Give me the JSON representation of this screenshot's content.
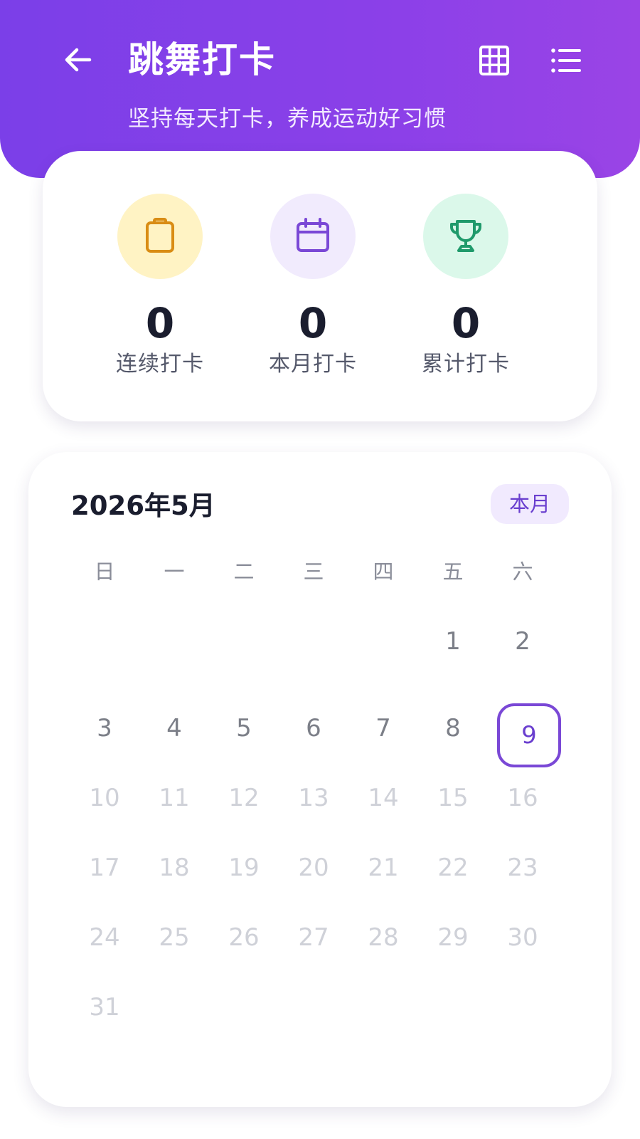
{
  "header": {
    "title": "跳舞打卡",
    "subtitle": "坚持每天打卡，养成运动好习惯",
    "accent_color": "#8b40e8",
    "icons": [
      "arrow-left-icon",
      "grid-icon",
      "list-icon"
    ]
  },
  "stats": [
    {
      "value": "0",
      "label": "连续打卡",
      "icon": "clipboard-icon",
      "icon_color": "#d98c14",
      "bg_color": "#fff3c4"
    },
    {
      "value": "0",
      "label": "本月打卡",
      "icon": "calendar-icon",
      "icon_color": "#7a48d6",
      "bg_color": "#f1ebfd"
    },
    {
      "value": "0",
      "label": "累计打卡",
      "icon": "trophy-icon",
      "icon_color": "#1f9a6b",
      "bg_color": "#dbf8ea"
    }
  ],
  "calendar": {
    "month_label": "2026年5月",
    "today_button": "本月",
    "weekdays": [
      "日",
      "一",
      "二",
      "三",
      "四",
      "五",
      "六"
    ],
    "days": [
      "1",
      "2",
      "3",
      "4",
      "5",
      "6",
      "7",
      "8",
      "9",
      "10",
      "11",
      "12",
      "13",
      "14",
      "15",
      "16",
      "17",
      "18",
      "19",
      "20",
      "21",
      "22",
      "23",
      "24",
      "25",
      "26",
      "27",
      "28",
      "29",
      "30",
      "31"
    ],
    "today": "9",
    "today_color": "#7a48d6"
  }
}
